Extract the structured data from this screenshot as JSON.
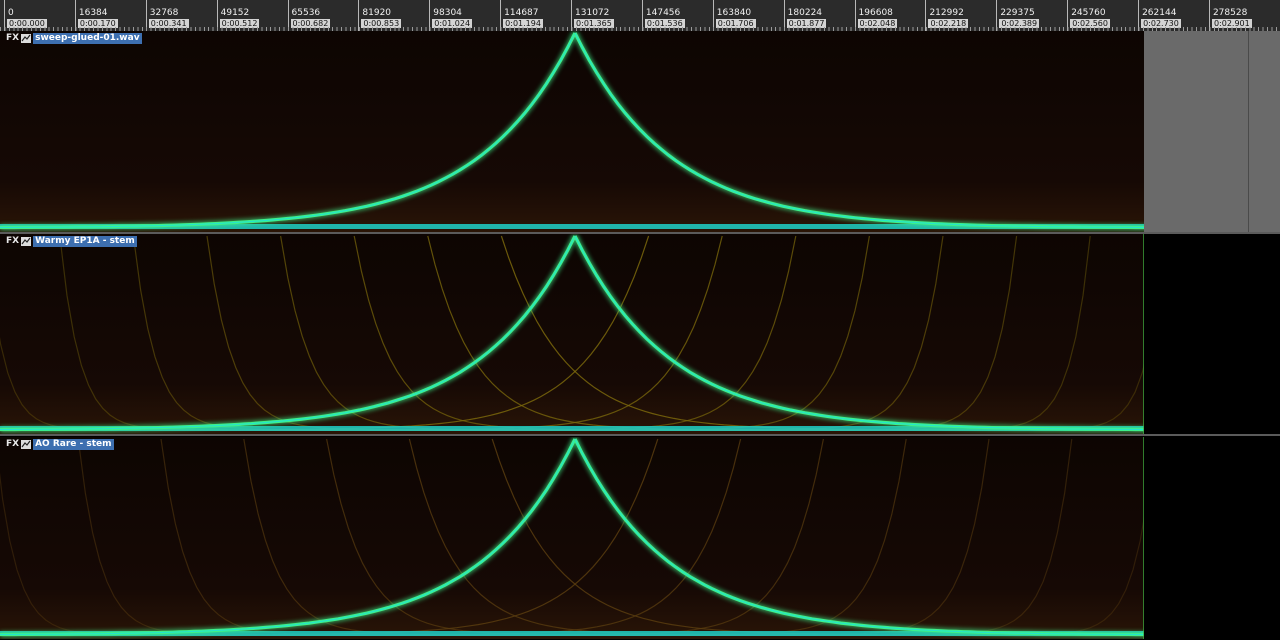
{
  "ruler": {
    "ticks": [
      {
        "samples": "0",
        "time": "0:00.000"
      },
      {
        "samples": "16384",
        "time": "0:00.170"
      },
      {
        "samples": "32768",
        "time": "0:00.341"
      },
      {
        "samples": "49152",
        "time": "0:00.512"
      },
      {
        "samples": "65536",
        "time": "0:00.682"
      },
      {
        "samples": "81920",
        "time": "0:00.853"
      },
      {
        "samples": "98304",
        "time": "0:01.024"
      },
      {
        "samples": "114687",
        "time": "0:01.194"
      },
      {
        "samples": "131072",
        "time": "0:01.365"
      },
      {
        "samples": "147456",
        "time": "0:01.536"
      },
      {
        "samples": "163840",
        "time": "0:01.706"
      },
      {
        "samples": "180224",
        "time": "0:01.877"
      },
      {
        "samples": "196608",
        "time": "0:02.048"
      },
      {
        "samples": "212992",
        "time": "0:02.218"
      },
      {
        "samples": "229375",
        "time": "0:02.389"
      },
      {
        "samples": "245760",
        "time": "0:02.560"
      },
      {
        "samples": "262144",
        "time": "0:02.730"
      },
      {
        "samples": "278528",
        "time": "0:02.901"
      }
    ]
  },
  "tracks": [
    {
      "fx_label": "FX",
      "name": "sweep-glued-01.wav"
    },
    {
      "fx_label": "FX",
      "name": "Warmy EP1A - stem"
    },
    {
      "fx_label": "FX",
      "name": "AO Rare - stem"
    }
  ],
  "colors": {
    "main_curve": "#3df08a",
    "curve_core": "#1fe0e0",
    "harmonic": "#8a7a10",
    "background": "#120804"
  }
}
